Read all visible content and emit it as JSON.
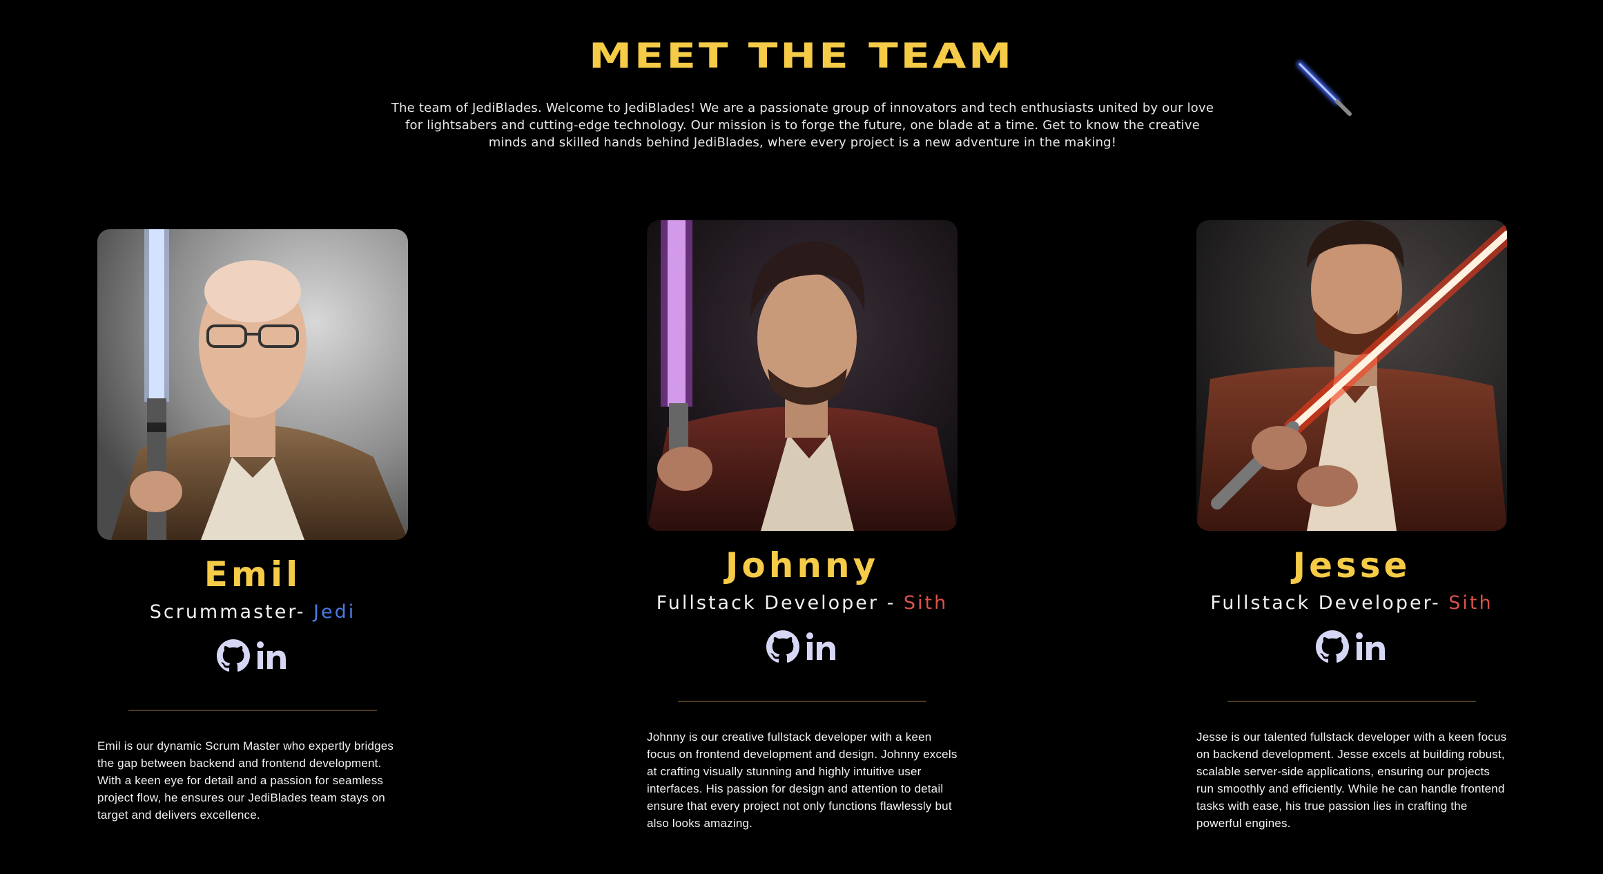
{
  "header": {
    "title": "MEET THE TEAM",
    "intro": "The team of JediBlades. Welcome to JediBlades! We are a passionate group of innovators and tech enthusiasts united by our love for lightsabers and cutting-edge technology. Our mission is to forge the future, one blade at a time. Get to know the creative minds and skilled hands behind JediBlades, where every project is a new adventure in the making!"
  },
  "team": [
    {
      "name": "Emil",
      "role": "Scrummaster- ",
      "side": "Jedi",
      "bio": "Emil is our dynamic Scrum Master who expertly bridges the gap between backend and frontend development. With a keen eye for detail and a passion for seamless project flow, he ensures our JediBlades team stays on target and delivers excellence."
    },
    {
      "name": "Johnny",
      "role": "Fullstack Developer - ",
      "side": "Sith",
      "bio": "Johnny is our creative fullstack developer with a keen focus on frontend development and design. Johnny excels at crafting visually stunning and highly intuitive user interfaces. His passion for design and attention to detail ensure that every project not only functions flawlessly but also looks amazing."
    },
    {
      "name": "Jesse",
      "role": "Fullstack Developer- ",
      "side": "Sith",
      "bio": "Jesse is our talented fullstack developer with a keen focus on backend development. Jesse excels at building robust, scalable server-side applications, ensuring our projects run smoothly and efficiently. While he can handle frontend tasks with ease, his true passion lies in crafting the powerful engines."
    }
  ],
  "icons": {
    "github": "github-icon",
    "linkedin": "linkedin-icon",
    "decoration": "lightsaber-icon"
  },
  "colors": {
    "background": "#000000",
    "accent_gold": "#f5cb47",
    "jedi_blue": "#4a7be6",
    "sith_red": "#d9534a",
    "icon_lavender": "#d6d6f5"
  }
}
